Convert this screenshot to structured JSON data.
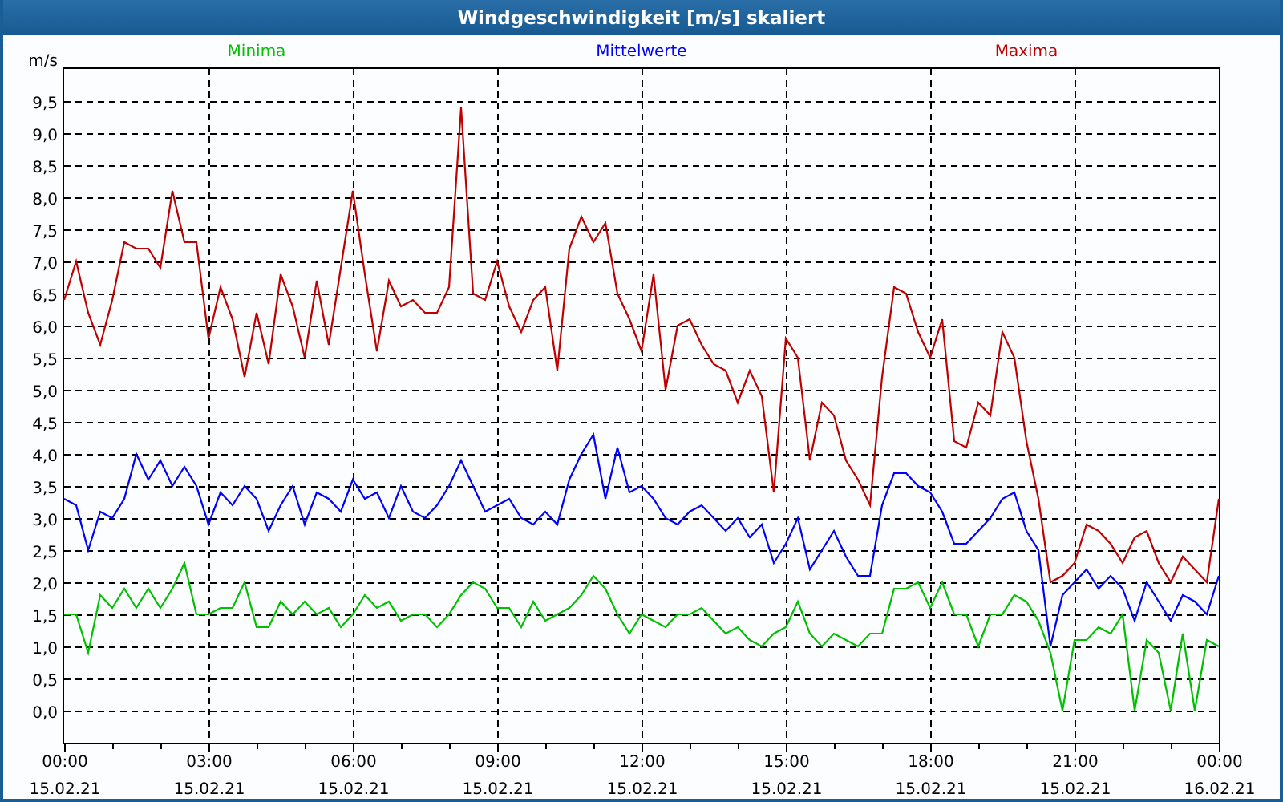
{
  "window": {
    "title": "Windgeschwindigkeit [m/s] skaliert"
  },
  "chart": {
    "chart_data": {
      "type": "line",
      "ylabel": "m/s",
      "xlim": [
        0,
        24
      ],
      "ylim": [
        -0.5,
        10
      ],
      "x": [
        0,
        0.25,
        0.5,
        0.75,
        1,
        1.25,
        1.5,
        1.75,
        2,
        2.25,
        2.5,
        2.75,
        3,
        3.25,
        3.5,
        3.75,
        4,
        4.25,
        4.5,
        4.75,
        5,
        5.25,
        5.5,
        5.75,
        6,
        6.25,
        6.5,
        6.75,
        7,
        7.25,
        7.5,
        7.75,
        8,
        8.25,
        8.5,
        8.75,
        9,
        9.25,
        9.5,
        9.75,
        10,
        10.25,
        10.5,
        10.75,
        11,
        11.25,
        11.5,
        11.75,
        12,
        12.25,
        12.5,
        12.75,
        13,
        13.25,
        13.5,
        13.75,
        14,
        14.25,
        14.5,
        14.75,
        15,
        15.25,
        15.5,
        15.75,
        16,
        16.25,
        16.5,
        16.75,
        17,
        17.25,
        17.5,
        17.75,
        18,
        18.25,
        18.5,
        18.75,
        19,
        19.25,
        19.5,
        19.75,
        20,
        20.25,
        20.5,
        20.75,
        21,
        21.25,
        21.5,
        21.75,
        22,
        22.25,
        22.5,
        22.75,
        23,
        23.25,
        23.5,
        23.75,
        24
      ],
      "series": [
        {
          "name": "Minima",
          "color": "#00c000",
          "values": [
            1.5,
            1.5,
            0.9,
            1.8,
            1.6,
            1.9,
            1.6,
            1.9,
            1.6,
            1.9,
            2.3,
            1.5,
            1.5,
            1.6,
            1.6,
            2.0,
            1.3,
            1.3,
            1.7,
            1.5,
            1.7,
            1.5,
            1.6,
            1.3,
            1.5,
            1.8,
            1.6,
            1.7,
            1.4,
            1.5,
            1.5,
            1.3,
            1.5,
            1.8,
            2.0,
            1.9,
            1.6,
            1.6,
            1.3,
            1.7,
            1.4,
            1.5,
            1.6,
            1.8,
            2.1,
            1.9,
            1.5,
            1.2,
            1.5,
            1.4,
            1.3,
            1.5,
            1.5,
            1.6,
            1.4,
            1.2,
            1.3,
            1.1,
            1.0,
            1.2,
            1.3,
            1.7,
            1.2,
            1.0,
            1.2,
            1.1,
            1.0,
            1.2,
            1.2,
            1.9,
            1.9,
            2.0,
            1.6,
            2.0,
            1.5,
            1.5,
            1.0,
            1.5,
            1.5,
            1.8,
            1.7,
            1.4,
            0.9,
            0.0,
            1.1,
            1.1,
            1.3,
            1.2,
            1.5,
            0.0,
            1.1,
            0.9,
            0.0,
            1.2,
            0.0,
            1.1,
            1.0
          ]
        },
        {
          "name": "Mittelwerte",
          "color": "#0000ff",
          "values": [
            3.3,
            3.2,
            2.5,
            3.1,
            3.0,
            3.3,
            4.0,
            3.6,
            3.9,
            3.5,
            3.8,
            3.5,
            2.9,
            3.4,
            3.2,
            3.5,
            3.3,
            2.8,
            3.2,
            3.5,
            2.9,
            3.4,
            3.3,
            3.1,
            3.6,
            3.3,
            3.4,
            3.0,
            3.5,
            3.1,
            3.0,
            3.2,
            3.5,
            3.9,
            3.5,
            3.1,
            3.2,
            3.3,
            3.0,
            2.9,
            3.1,
            2.9,
            3.6,
            4.0,
            4.3,
            3.3,
            4.1,
            3.4,
            3.5,
            3.3,
            3.0,
            2.9,
            3.1,
            3.2,
            3.0,
            2.8,
            3.0,
            2.7,
            2.9,
            2.3,
            2.6,
            3.0,
            2.2,
            2.5,
            2.8,
            2.4,
            2.1,
            2.1,
            3.2,
            3.7,
            3.7,
            3.5,
            3.4,
            3.1,
            2.6,
            2.6,
            2.8,
            3.0,
            3.3,
            3.4,
            2.8,
            2.5,
            1.0,
            1.8,
            2.0,
            2.2,
            1.9,
            2.1,
            1.9,
            1.4,
            2.0,
            1.7,
            1.4,
            1.8,
            1.7,
            1.5,
            2.1
          ]
        },
        {
          "name": "Maxima",
          "color": "#c00000",
          "values": [
            6.4,
            7.0,
            6.2,
            5.7,
            6.4,
            7.3,
            7.2,
            7.2,
            6.9,
            8.1,
            7.3,
            7.3,
            5.8,
            6.6,
            6.1,
            5.2,
            6.2,
            5.4,
            6.8,
            6.3,
            5.5,
            6.7,
            5.7,
            6.9,
            8.1,
            6.8,
            5.6,
            6.7,
            6.3,
            6.4,
            6.2,
            6.2,
            6.6,
            9.4,
            6.5,
            6.4,
            7.0,
            6.3,
            5.9,
            6.4,
            6.6,
            5.3,
            7.2,
            7.7,
            7.3,
            7.6,
            6.5,
            6.1,
            5.6,
            6.8,
            5.0,
            6.0,
            6.1,
            5.7,
            5.4,
            5.3,
            4.8,
            5.3,
            4.9,
            3.4,
            5.8,
            5.5,
            3.9,
            4.8,
            4.6,
            3.9,
            3.6,
            3.2,
            5.2,
            6.6,
            6.5,
            5.9,
            5.5,
            6.1,
            4.2,
            4.1,
            4.8,
            4.6,
            5.9,
            5.5,
            4.2,
            3.3,
            2.0,
            2.1,
            2.3,
            2.9,
            2.8,
            2.6,
            2.3,
            2.7,
            2.8,
            2.3,
            2.0,
            2.4,
            2.2,
            2.0,
            3.3
          ]
        }
      ],
      "grid": true,
      "xticks": [
        {
          "value": 0,
          "label": "00:00"
        },
        {
          "value": 3,
          "label": "03:00"
        },
        {
          "value": 6,
          "label": "06:00"
        },
        {
          "value": 9,
          "label": "09:00"
        },
        {
          "value": 12,
          "label": "12:00"
        },
        {
          "value": 15,
          "label": "15:00"
        },
        {
          "value": 18,
          "label": "18:00"
        },
        {
          "value": 21,
          "label": "21:00"
        },
        {
          "value": 24,
          "label": "00:00"
        }
      ],
      "annotations": [
        "15.02.21",
        "15.02.21",
        "15.02.21",
        "15.02.21",
        "15.02.21",
        "15.02.21",
        "15.02.21",
        "15.02.21",
        "16.02.21"
      ],
      "yticks": [
        {
          "value": 0,
          "label": "0,0"
        },
        {
          "value": 0.5,
          "label": "0,5"
        },
        {
          "value": 1,
          "label": "1,0"
        },
        {
          "value": 1.5,
          "label": "1,5"
        },
        {
          "value": 2,
          "label": "2,0"
        },
        {
          "value": 2.5,
          "label": "2,5"
        },
        {
          "value": 3,
          "label": "3,0"
        },
        {
          "value": 3.5,
          "label": "3,5"
        },
        {
          "value": 4,
          "label": "4,0"
        },
        {
          "value": 4.5,
          "label": "4,5"
        },
        {
          "value": 5,
          "label": "5,0"
        },
        {
          "value": 5.5,
          "label": "5,5"
        },
        {
          "value": 6,
          "label": "6,0"
        },
        {
          "value": 6.5,
          "label": "6,5"
        },
        {
          "value": 7,
          "label": "7,0"
        },
        {
          "value": 7.5,
          "label": "7,5"
        },
        {
          "value": 8,
          "label": "8,0"
        },
        {
          "value": 8.5,
          "label": "8,5"
        },
        {
          "value": 9,
          "label": "9,0"
        },
        {
          "value": 9.5,
          "label": "9,5"
        }
      ]
    }
  }
}
